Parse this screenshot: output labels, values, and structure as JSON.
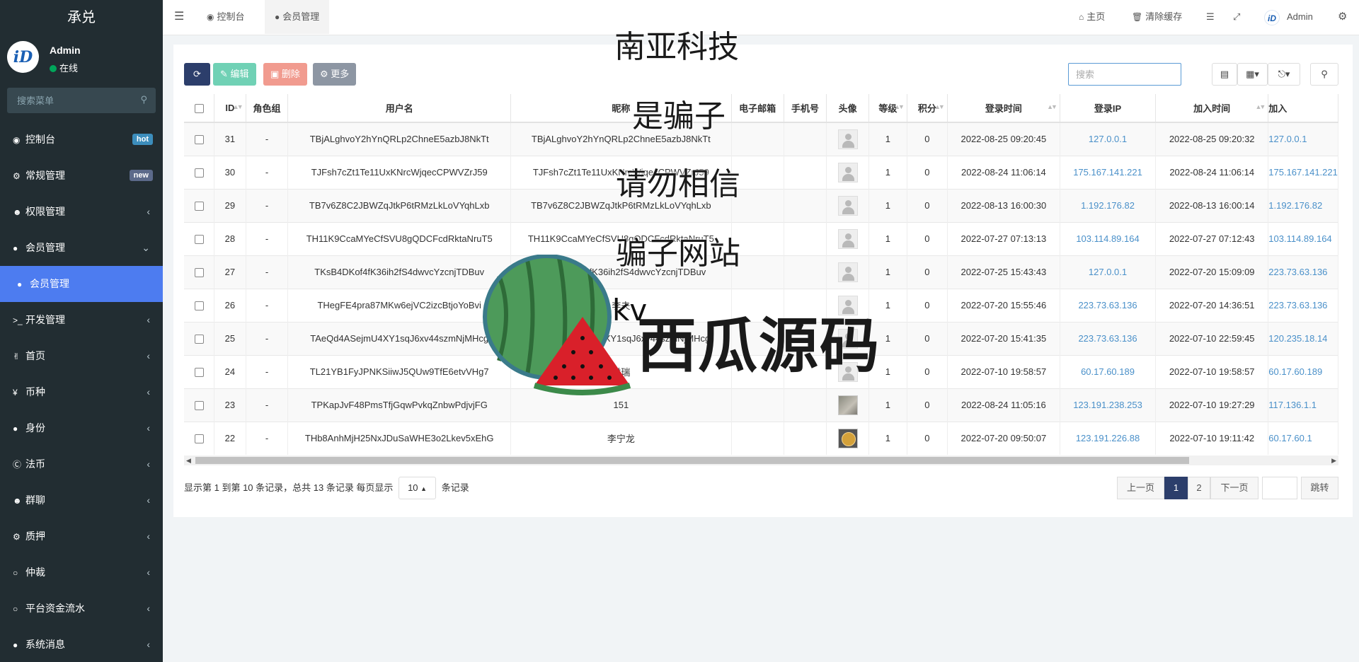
{
  "sidebar": {
    "logo": "承兑",
    "user": {
      "name": "Admin",
      "status": "在线"
    },
    "search_placeholder": "搜索菜单",
    "items": [
      {
        "label": "控制台",
        "icon": "dashboard-icon",
        "badge": "hot",
        "badge_color": "#3c8dbc"
      },
      {
        "label": "常规管理",
        "icon": "cogs-icon",
        "badge": "new",
        "badge_color": "#5c6a8a"
      },
      {
        "label": "权限管理",
        "icon": "group-icon"
      },
      {
        "label": "会员管理",
        "icon": "user-circle-icon",
        "expanded": true
      },
      {
        "label": "会员管理",
        "icon": "user-icon",
        "active": true
      },
      {
        "label": "开发管理",
        "icon": "terminal-icon"
      },
      {
        "label": "首页",
        "icon": "hand-icon"
      },
      {
        "label": "币种",
        "icon": "yen-icon"
      },
      {
        "label": "身份",
        "icon": "user-icon"
      },
      {
        "label": "法币",
        "icon": "skype-icon"
      },
      {
        "label": "群聊",
        "icon": "group-icon"
      },
      {
        "label": "质押",
        "icon": "gear-icon"
      },
      {
        "label": "仲裁",
        "icon": "circle-icon"
      },
      {
        "label": "平台资金流水",
        "icon": "circle-icon"
      },
      {
        "label": "系统消息",
        "icon": "comment-icon"
      }
    ]
  },
  "topbar": {
    "tabs": [
      {
        "label": "控制台"
      },
      {
        "label": "会员管理"
      }
    ],
    "right": {
      "home": "主页",
      "clear_cache": "清除缓存",
      "admin": "Admin"
    }
  },
  "toolbar": {
    "edit": "编辑",
    "delete": "删除",
    "more": "更多",
    "search_placeholder": "搜索"
  },
  "table": {
    "columns": [
      "ID",
      "角色组",
      "用户名",
      "昵称",
      "电子邮箱",
      "手机号",
      "头像",
      "等级",
      "积分",
      "登录时间",
      "登录IP",
      "加入时间",
      "加入"
    ],
    "rows": [
      {
        "id": "31",
        "group": "-",
        "username": "TBjALghvoY2hYnQRLp2ChneE5azbJ8NkTt",
        "nickname": "TBjALghvoY2hYnQRLp2ChneE5azbJ8NkTt",
        "email": "",
        "mobile": "",
        "avatar": "default",
        "level": "1",
        "score": "0",
        "logintime": "2022-08-25 09:20:45",
        "loginip": "127.0.0.1",
        "jointime": "2022-08-25 09:20:32",
        "joinip": "127.0.0.1"
      },
      {
        "id": "30",
        "group": "-",
        "username": "TJFsh7cZt1Te11UxKNrcWjqecCPWVZrJ59",
        "nickname": "TJFsh7cZt1Te11UxKNrcWjqecCPWVZrJ59",
        "email": "",
        "mobile": "",
        "avatar": "default",
        "level": "1",
        "score": "0",
        "logintime": "2022-08-24 11:06:14",
        "loginip": "175.167.141.221",
        "jointime": "2022-08-24 11:06:14",
        "joinip": "175.167.141.221"
      },
      {
        "id": "29",
        "group": "-",
        "username": "TB7v6Z8C2JBWZqJtkP6tRMzLkLoVYqhLxb",
        "nickname": "TB7v6Z8C2JBWZqJtkP6tRMzLkLoVYqhLxb",
        "email": "",
        "mobile": "",
        "avatar": "default",
        "level": "1",
        "score": "0",
        "logintime": "2022-08-13 16:00:30",
        "loginip": "1.192.176.82",
        "jointime": "2022-08-13 16:00:14",
        "joinip": "1.192.176.82"
      },
      {
        "id": "28",
        "group": "-",
        "username": "TH11K9CcaMYeCfSVU8gQDCFcdRktaNruT5",
        "nickname": "TH11K9CcaMYeCfSVU8gQDCFcdRktaNruT5",
        "email": "",
        "mobile": "",
        "avatar": "default",
        "level": "1",
        "score": "0",
        "logintime": "2022-07-27 07:13:13",
        "loginip": "103.114.89.164",
        "jointime": "2022-07-27 07:12:43",
        "joinip": "103.114.89.164"
      },
      {
        "id": "27",
        "group": "-",
        "username": "TKsB4DKof4fK36ih2fS4dwvcYzcnjTDBuv",
        "nickname": "TKsB4DKof4fK36ih2fS4dwvcYzcnjTDBuv",
        "email": "",
        "mobile": "",
        "avatar": "default",
        "level": "1",
        "score": "0",
        "logintime": "2022-07-25 15:43:43",
        "loginip": "127.0.0.1",
        "jointime": "2022-07-20 15:09:09",
        "joinip": "223.73.63.136"
      },
      {
        "id": "26",
        "group": "-",
        "username": "THegFE4pra87MKw6ejVC2izcBtjoYoBvi",
        "nickname": "李夫",
        "email": "",
        "mobile": "",
        "avatar": "default",
        "level": "1",
        "score": "0",
        "logintime": "2022-07-20 15:55:46",
        "loginip": "223.73.63.136",
        "jointime": "2022-07-20 14:36:51",
        "joinip": "223.73.63.136"
      },
      {
        "id": "25",
        "group": "-",
        "username": "TAeQd4ASejmU4XY1sqJ6xv44szmNjMHcg",
        "nickname": "TAeQd4ASejmU4XY1sqJ6xv44szmNjMHcg",
        "email": "",
        "mobile": "",
        "avatar": "default",
        "level": "1",
        "score": "0",
        "logintime": "2022-07-20 15:41:35",
        "loginip": "223.73.63.136",
        "jointime": "2022-07-10 22:59:45",
        "joinip": "120.235.18.14"
      },
      {
        "id": "24",
        "group": "-",
        "username": "TL21YB1FyJPNKSiiwJ5QUw9TfE6etvVHg7",
        "nickname": "洪瑞",
        "email": "",
        "mobile": "",
        "avatar": "default",
        "level": "1",
        "score": "0",
        "logintime": "2022-07-10 19:58:57",
        "loginip": "60.17.60.189",
        "jointime": "2022-07-10 19:58:57",
        "joinip": "60.17.60.189"
      },
      {
        "id": "23",
        "group": "-",
        "username": "TPKapJvF48PmsTfjGqwPvkqZnbwPdjvjFG",
        "nickname": "151",
        "email": "",
        "mobile": "",
        "avatar": "photo",
        "level": "1",
        "score": "0",
        "logintime": "2022-08-24 11:05:16",
        "loginip": "123.191.238.253",
        "jointime": "2022-07-10 19:27:29",
        "joinip": "117.136.1.1"
      },
      {
        "id": "22",
        "group": "-",
        "username": "THb8AnhMjH25NxJDuSaWHE3o2Lkev5xEhG",
        "nickname": "李宁龙",
        "email": "",
        "mobile": "",
        "avatar": "gold",
        "level": "1",
        "score": "0",
        "logintime": "2022-07-20 09:50:07",
        "loginip": "123.191.226.88",
        "jointime": "2022-07-10 19:11:42",
        "joinip": "60.17.60.1"
      }
    ]
  },
  "footer": {
    "summary": "显示第 1 到第 10 条记录，总共 13 条记录 每页显示",
    "page_size": "10",
    "suffix": "条记录",
    "prev": "上一页",
    "pages": [
      "1",
      "2"
    ],
    "next": "下一页",
    "jump": "跳转"
  },
  "watermark": {
    "lines": [
      "南亚科技",
      "是骗子",
      "请勿相信",
      "骗子网站"
    ],
    "brand": "西瓜源码",
    "kv": "kv"
  }
}
